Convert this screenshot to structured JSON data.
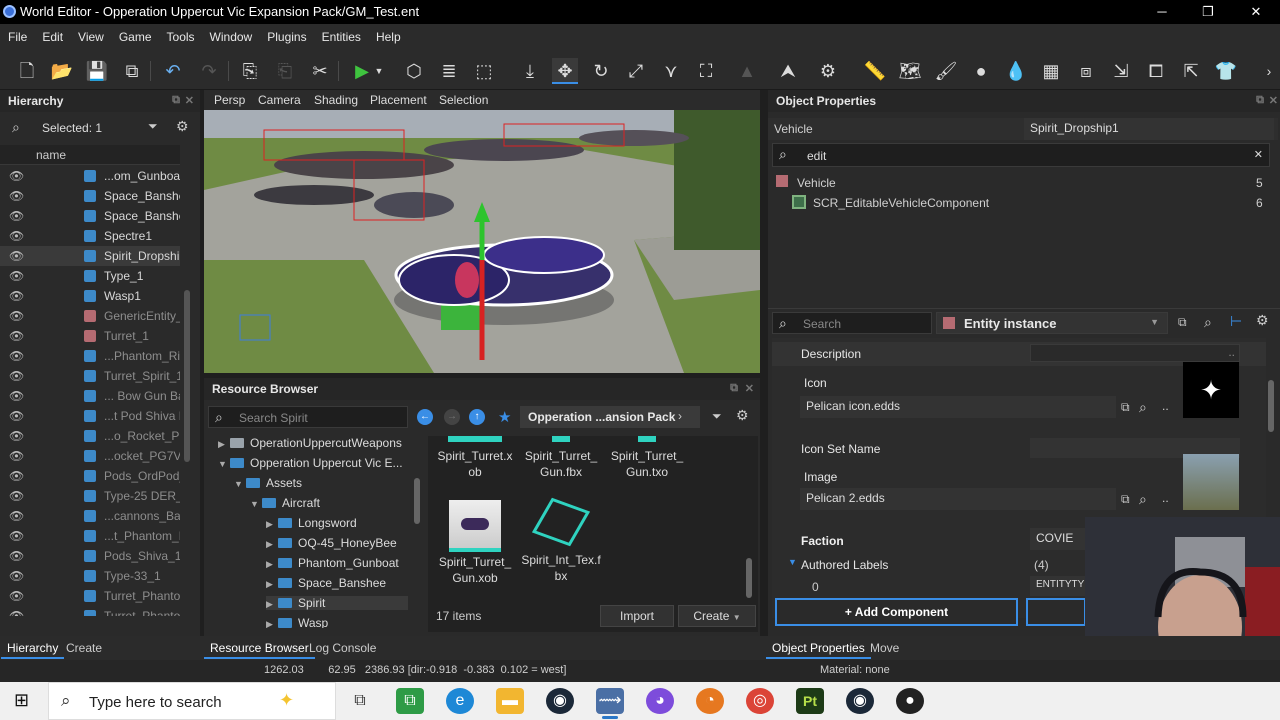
{
  "window": {
    "title": "World Editor - Opperation Uppercut Vic Expansion Pack/GM_Test.ent",
    "min": "─",
    "restore": "❐",
    "close": "✕"
  },
  "menu": [
    "File",
    "Edit",
    "View",
    "Game",
    "Tools",
    "Window",
    "Plugins",
    "Entities",
    "Help"
  ],
  "hierarchy": {
    "title": "Hierarchy",
    "selected": "Selected: 1",
    "column": "name",
    "rows": [
      {
        "label": "...om_Gunboat",
        "color": "blue"
      },
      {
        "label": "Space_Banshee",
        "color": "blue"
      },
      {
        "label": "Space_Banshee",
        "color": "blue"
      },
      {
        "label": "Spectre1",
        "color": "blue"
      },
      {
        "label": "Spirit_Dropship",
        "color": "blue",
        "selected": true
      },
      {
        "label": "Type_1",
        "color": "blue"
      },
      {
        "label": "Wasp1",
        "color": "blue"
      },
      {
        "label": "GenericEntity_",
        "color": "red",
        "dim": true
      },
      {
        "label": "Turret_1",
        "color": "red",
        "dim": true
      },
      {
        "label": "...Phantom_Ric",
        "color": "blue",
        "dim": true
      },
      {
        "label": "Turret_Spirit_1",
        "color": "blue",
        "dim": true
      },
      {
        "label": "... Bow Gun Ba",
        "color": "blue",
        "dim": true
      },
      {
        "label": "...t Pod Shiva N",
        "color": "blue",
        "dim": true
      },
      {
        "label": "...o_Rocket_PG",
        "color": "blue",
        "dim": true
      },
      {
        "label": "...ocket_PG7V_",
        "color": "blue",
        "dim": true
      },
      {
        "label": "Pods_OrdPod_",
        "color": "blue",
        "dim": true
      },
      {
        "label": "Type-25 DER_1",
        "color": "blue",
        "dim": true
      },
      {
        "label": "...cannons_Bar",
        "color": "blue",
        "dim": true
      },
      {
        "label": "...t_Phantom_L",
        "color": "blue",
        "dim": true
      },
      {
        "label": "Pods_Shiva_1",
        "color": "blue",
        "dim": true
      },
      {
        "label": "Type-33_1",
        "color": "blue",
        "dim": true
      },
      {
        "label": "Turret_Phanton",
        "color": "blue",
        "dim": true
      },
      {
        "label": "Turret_Phanton",
        "color": "blue",
        "dim": true
      }
    ]
  },
  "viewport": {
    "tabs": [
      "Persp",
      "Camera",
      "Shading",
      "Placement",
      "Selection"
    ]
  },
  "resource_browser": {
    "title": "Resource Browser",
    "search_placeholder": "Search Spirit",
    "path": "Opperation ...ansion Pack",
    "path_more": "›",
    "tree": [
      {
        "label": "OperationUppercutWeapons",
        "indent": 0,
        "arrow": "▶",
        "type": "gray"
      },
      {
        "label": "Opperation Uppercut Vic E...",
        "indent": 0,
        "arrow": "▼",
        "type": "blue"
      },
      {
        "label": "Assets",
        "indent": 1,
        "arrow": "▼",
        "type": "blue"
      },
      {
        "label": "Aircraft",
        "indent": 2,
        "arrow": "▼",
        "type": "blue"
      },
      {
        "label": "Longsword",
        "indent": 3,
        "arrow": "▶",
        "type": "blue"
      },
      {
        "label": "OQ-45_HoneyBee",
        "indent": 3,
        "arrow": "▶",
        "type": "blue"
      },
      {
        "label": "Phantom_Gunboat",
        "indent": 3,
        "arrow": "▶",
        "type": "blue"
      },
      {
        "label": "Space_Banshee",
        "indent": 3,
        "arrow": "▶",
        "type": "blue"
      },
      {
        "label": "Spirit",
        "indent": 3,
        "arrow": "▶",
        "type": "blue",
        "selected": true
      },
      {
        "label": "Wasp",
        "indent": 3,
        "arrow": "▶",
        "type": "blue"
      }
    ],
    "assets_top": [
      "Spirit_Turret.x\nob",
      "Spirit_Turret_\nGun.fbx",
      "Spirit_Turret_\nGun.txo"
    ],
    "assets_row2": [
      "Spirit_Turret_\nGun.xob",
      "Spirit_Int_Tex.f\nbx"
    ],
    "item_count": "17 items",
    "import": "Import",
    "create": "Create"
  },
  "object_properties": {
    "title": "Object Properties",
    "class_label": "Vehicle",
    "name_value": "Spirit_Dropship1",
    "filter_value": "edit",
    "results": [
      {
        "label": "Vehicle",
        "count": "5"
      },
      {
        "label": "SCR_EditableVehicleComponent",
        "count": "6"
      }
    ],
    "search_placeholder": "Search",
    "entity_dropdown": "Entity instance",
    "description_label": "Description",
    "icon_label": "Icon",
    "icon_value": "Pelican icon.edds",
    "icon_set_label": "Icon Set Name",
    "image_label": "Image",
    "image_value": "Pelican 2.edds",
    "faction_label": "Faction",
    "faction_value": "COVIE",
    "authored_label": "Authored Labels",
    "authored_count": "(4)",
    "index0": "0",
    "entity_type_partial": "ENTITYTYP",
    "add_component": "+ Add Component",
    "browse_btn": ".."
  },
  "bottom_tabs": {
    "hierarchy": "Hierarchy",
    "create": "Create",
    "resource_browser": "Resource Browser",
    "log_console": "Log Console",
    "object_properties": "Object Properties",
    "move": "Move"
  },
  "status": {
    "coords": "1262.03        62.95   2386.93 [dir:-0.918  -0.383  0.102 = west]",
    "material": "Material: none"
  },
  "taskbar": {
    "search_placeholder": "Type here to search"
  },
  "colors": {
    "accent": "#3a8ee6",
    "selection": "#3a3a3a",
    "cube_blue": "#3d8ac9",
    "cube_red": "#b56b72"
  }
}
